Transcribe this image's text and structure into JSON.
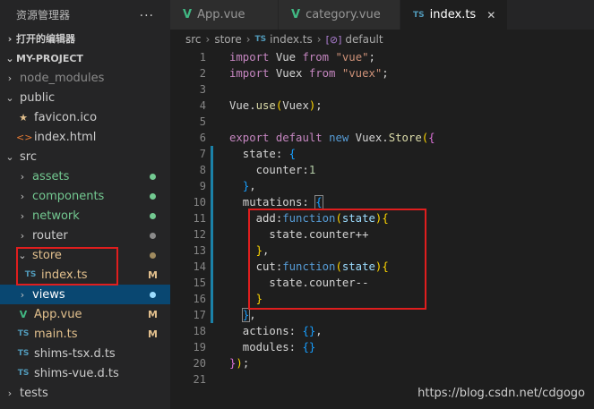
{
  "sidebar": {
    "title": "资源管理器",
    "more_icon": "...",
    "open_editors": "打开的编辑器",
    "project": "MY-PROJECT",
    "items": [
      {
        "label": "node_modules",
        "type": "folder",
        "open": false,
        "color": "#8b8b8b"
      },
      {
        "label": "public",
        "type": "folder",
        "open": true,
        "color": "#cccccc"
      },
      {
        "label": "favicon.ico",
        "type": "file",
        "icon": "star-icon",
        "color": "#cccccc"
      },
      {
        "label": "index.html",
        "type": "file",
        "icon": "html-icon",
        "color": "#cccccc"
      },
      {
        "label": "src",
        "type": "folder",
        "open": true,
        "color": "#cccccc"
      },
      {
        "label": "assets",
        "type": "folder",
        "open": false,
        "color": "#73c991"
      },
      {
        "label": "components",
        "type": "folder",
        "open": false,
        "color": "#73c991"
      },
      {
        "label": "network",
        "type": "folder",
        "open": false,
        "color": "#73c991"
      },
      {
        "label": "router",
        "type": "folder",
        "open": false,
        "color": "#cccccc"
      },
      {
        "label": "store",
        "type": "folder",
        "open": true,
        "color": "#e2c08d"
      },
      {
        "label": "index.ts",
        "type": "file",
        "icon": "ts-icon",
        "color": "#e2c08d",
        "badge": "M"
      },
      {
        "label": "views",
        "type": "folder",
        "open": false,
        "color": "#ffffff",
        "selected": true
      },
      {
        "label": "App.vue",
        "type": "file",
        "icon": "vue-icon",
        "color": "#e2c08d",
        "badge": "M"
      },
      {
        "label": "main.ts",
        "type": "file",
        "icon": "ts-icon",
        "color": "#e2c08d",
        "badge": "M"
      },
      {
        "label": "shims-tsx.d.ts",
        "type": "file",
        "icon": "ts-icon",
        "color": "#cccccc"
      },
      {
        "label": "shims-vue.d.ts",
        "type": "file",
        "icon": "ts-icon",
        "color": "#cccccc"
      },
      {
        "label": "tests",
        "type": "folder",
        "open": false,
        "color": "#cccccc"
      }
    ]
  },
  "tabs": [
    {
      "label": "App.vue",
      "icon": "V"
    },
    {
      "label": "category.vue",
      "icon": "V"
    },
    {
      "label": "index.ts",
      "icon": "TS",
      "active": true
    }
  ],
  "breadcrumb": {
    "parts": [
      "src",
      "store",
      "index.ts",
      "default"
    ],
    "ts_icon": "TS",
    "default_icon": "[⊘]"
  },
  "code": {
    "line_numbers": [
      "1",
      "2",
      "3",
      "4",
      "5",
      "6",
      "7",
      "8",
      "9",
      "10",
      "11",
      "12",
      "13",
      "14",
      "15",
      "16",
      "17",
      "18",
      "19",
      "20",
      "21"
    ]
  },
  "watermark": "https://blog.csdn.net/cdgogo"
}
